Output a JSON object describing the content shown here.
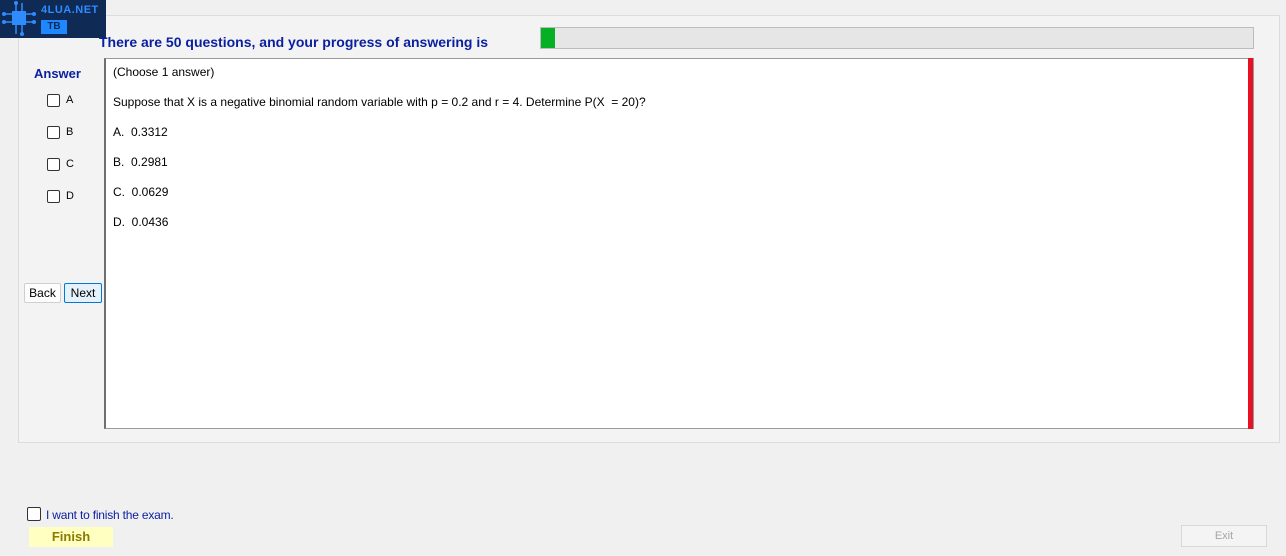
{
  "logo": {
    "line1": "4LUA.NET",
    "line2": "TB"
  },
  "progress": {
    "label": "There are 50 questions, and your progress of answering is",
    "value_percent": 2
  },
  "answer_panel": {
    "title": "Answer",
    "options": [
      "A",
      "B",
      "C",
      "D"
    ]
  },
  "nav": {
    "back_label": "Back",
    "next_label": "Next"
  },
  "question": {
    "instruction": "(Choose 1 answer)",
    "text": "Suppose that X is a negative binomial random variable with p = 0.2 and r = 4. Determine P(X  = 20)?",
    "choices": [
      "A.  0.3312",
      "B.  0.2981",
      "C.  0.0629",
      "D.  0.0436"
    ]
  },
  "footer": {
    "finish_check_label": "I want to finish the exam.",
    "finish_label": "Finish",
    "exit_label": "Exit"
  },
  "colors": {
    "accent": "#0a1fa0",
    "progress": "#06b025",
    "alert_bar": "#e81123",
    "finish_bg": "#ffffc2"
  }
}
